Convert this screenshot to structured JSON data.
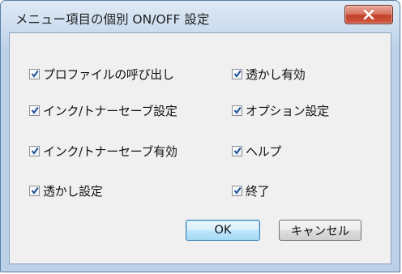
{
  "window": {
    "title": "メニュー項目の個別 ON/OFF 設定",
    "close_label": "x"
  },
  "options": [
    {
      "label": "プロファイルの呼び出し",
      "checked": true
    },
    {
      "label": "透かし有効",
      "checked": true
    },
    {
      "label": "インク/トナーセーブ設定",
      "checked": true
    },
    {
      "label": "オプション設定",
      "checked": true
    },
    {
      "label": "インク/トナーセーブ有効",
      "checked": true
    },
    {
      "label": "ヘルプ",
      "checked": true
    },
    {
      "label": "透かし設定",
      "checked": true
    },
    {
      "label": "終了",
      "checked": true
    }
  ],
  "buttons": {
    "ok_label": "OK",
    "cancel_label": "キャンセル"
  },
  "colors": {
    "checkmark": "#1f4f96",
    "close_button": "#c3412a",
    "focus_border": "#3c7fb1"
  }
}
